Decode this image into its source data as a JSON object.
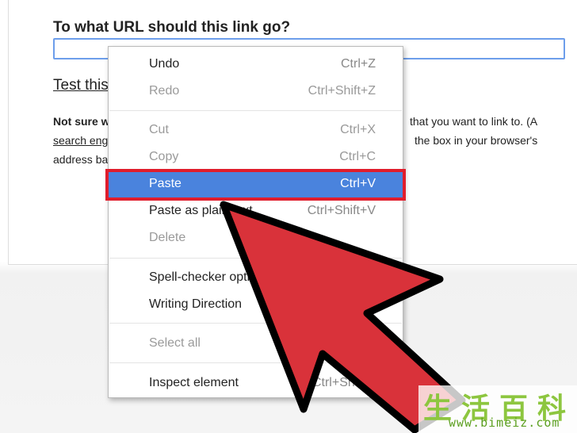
{
  "dialog": {
    "title": "To what URL should this link go?",
    "url_value": "",
    "test_link_label": "Test this l",
    "help_line1_bold": "Not sure w",
    "help_line1_rest": "that you want to link to. (A",
    "help_line2_link": "search engi",
    "help_line2_rest": "the box in your browser's",
    "help_line3": "address bar"
  },
  "context_menu": {
    "items": [
      {
        "label": "Undo",
        "shortcut": "Ctrl+Z",
        "disabled": false
      },
      {
        "label": "Redo",
        "shortcut": "Ctrl+Shift+Z",
        "disabled": true
      },
      {
        "label": "Cut",
        "shortcut": "Ctrl+X",
        "disabled": true
      },
      {
        "label": "Copy",
        "shortcut": "Ctrl+C",
        "disabled": true
      },
      {
        "label": "Paste",
        "shortcut": "Ctrl+V",
        "disabled": false,
        "highlighted": true
      },
      {
        "label": "Paste as plain text",
        "shortcut": "Ctrl+Shift+V",
        "disabled": false
      },
      {
        "label": "Delete",
        "shortcut": "",
        "disabled": true
      },
      {
        "label": "Spell-checker options",
        "shortcut": "",
        "disabled": false
      },
      {
        "label": "Writing Direction",
        "shortcut": "",
        "disabled": false
      },
      {
        "label": "Select all",
        "shortcut": "",
        "disabled": true
      },
      {
        "label": "Inspect element",
        "shortcut": "Ctrl+Shift+I",
        "disabled": false
      }
    ]
  },
  "watermark": {
    "chars": "生活百科",
    "url": "www.bimeiz.com"
  },
  "colors": {
    "highlight": "#4a83dd",
    "highlight_border": "#e01d2c",
    "arrow_fill": "#d9323a",
    "input_border": "#6d9eeb",
    "watermark_green": "#8dc63f"
  },
  "icons": {
    "pointer": "pointer-arrow-icon"
  }
}
